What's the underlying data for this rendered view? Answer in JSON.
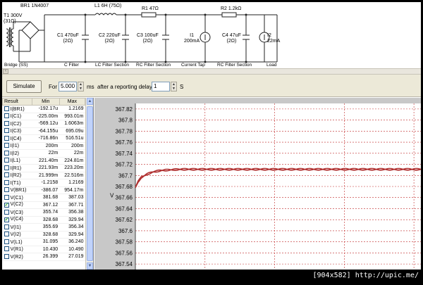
{
  "schematic": {
    "t1": [
      "T1 300V",
      "(31Ω)"
    ],
    "br1": "BR1 1N4007",
    "l1": "L1 6H (75Ω)",
    "r1": "R1 47Ω",
    "r2": "R2 1.2kΩ",
    "c1": [
      "C1 470uF",
      "(2Ω)"
    ],
    "c2": [
      "C2 220uF",
      "(2Ω)"
    ],
    "c3": [
      "C3 100uF",
      "(2Ω)"
    ],
    "i1": [
      "I1",
      "200mA"
    ],
    "c4": [
      "C4 47uF",
      "(2Ω)"
    ],
    "i2": [
      "I2",
      "22mA"
    ],
    "sections": [
      "Bridge (SS)",
      "C Filter",
      "LC Filter Section",
      "RC Filter Section",
      "Current Tap",
      "RC Filter Section",
      "Load"
    ]
  },
  "toolbar": {
    "simulate_label": "Simulate",
    "for_label": "For",
    "duration_value": "5.000",
    "ms_label": "ms",
    "after_label": "after a reporting delay of",
    "delay_value": "1",
    "s_label": "S"
  },
  "results": {
    "headers": [
      "Result",
      "Min",
      "Max"
    ],
    "rows": [
      {
        "name": "I(BR1)",
        "min": "-192.17u",
        "max": "1.2169",
        "checked": false
      },
      {
        "name": "I(C1)",
        "min": "-225.00m",
        "max": "993.01m",
        "checked": false
      },
      {
        "name": "I(C2)",
        "min": "-569.12u",
        "max": "1.6063m",
        "checked": false
      },
      {
        "name": "I(C3)",
        "min": "-64.155u",
        "max": "695.09u",
        "checked": false
      },
      {
        "name": "I(C4)",
        "min": "-716.86n",
        "max": "516.51u",
        "checked": false
      },
      {
        "name": "I(I1)",
        "min": "200m",
        "max": "200m",
        "checked": false
      },
      {
        "name": "I(I2)",
        "min": "22m",
        "max": "22m",
        "checked": false
      },
      {
        "name": "I(L1)",
        "min": "221.40m",
        "max": "224.81m",
        "checked": false
      },
      {
        "name": "I(R1)",
        "min": "221.93m",
        "max": "223.20m",
        "checked": false
      },
      {
        "name": "I(R2)",
        "min": "21.999m",
        "max": "22.516m",
        "checked": false
      },
      {
        "name": "I(T1)",
        "min": "-1.2158",
        "max": "1.2169",
        "checked": false
      },
      {
        "name": "V(BR1)",
        "min": "-386.07",
        "max": "954.17m",
        "checked": false
      },
      {
        "name": "V(C1)",
        "min": "381.68",
        "max": "387.03",
        "checked": false
      },
      {
        "name": "V(C2)",
        "min": "367.12",
        "max": "367.71",
        "checked": true
      },
      {
        "name": "V(C3)",
        "min": "355.74",
        "max": "356.38",
        "checked": false
      },
      {
        "name": "V(C4)",
        "min": "328.68",
        "max": "329.94",
        "checked": true
      },
      {
        "name": "V(I1)",
        "min": "355.69",
        "max": "356.34",
        "checked": false
      },
      {
        "name": "V(I2)",
        "min": "328.68",
        "max": "329.94",
        "checked": false
      },
      {
        "name": "V(L1)",
        "min": "31.095",
        "max": "36.240",
        "checked": false
      },
      {
        "name": "V(R1)",
        "min": "10.430",
        "max": "10.490",
        "checked": false
      },
      {
        "name": "V(R2)",
        "min": "26.399",
        "max": "27.019",
        "checked": false
      }
    ]
  },
  "chart_data": {
    "type": "line",
    "ylabel": "V",
    "ylim": [
      367.53,
      367.83
    ],
    "yticks": [
      367.82,
      367.8,
      367.78,
      367.76,
      367.74,
      367.72,
      367.7,
      367.68,
      367.66,
      367.64,
      367.62,
      367.6,
      367.58,
      367.56,
      367.54
    ],
    "grid": true,
    "series": [
      {
        "color": "#b03030",
        "x": [
          0,
          0.01,
          0.02,
          0.04,
          0.06,
          0.09,
          0.12,
          0.16,
          0.2,
          0.3,
          0.4,
          0.5,
          0.6,
          0.7,
          0.8,
          0.9,
          1.0
        ],
        "y": [
          367.678,
          367.689,
          367.696,
          367.702,
          367.706,
          367.709,
          367.71,
          367.711,
          367.711,
          367.711,
          367.711,
          367.711,
          367.711,
          367.711,
          367.711,
          367.711,
          367.711
        ],
        "ripple": 0.0015
      }
    ]
  },
  "caption": "[904x582] http://upic.me/",
  "colors": {
    "grid": "#c02828",
    "trace": "#b03030",
    "plot_bg": "#ffffff",
    "frame_bg": "#c8c8c8"
  }
}
